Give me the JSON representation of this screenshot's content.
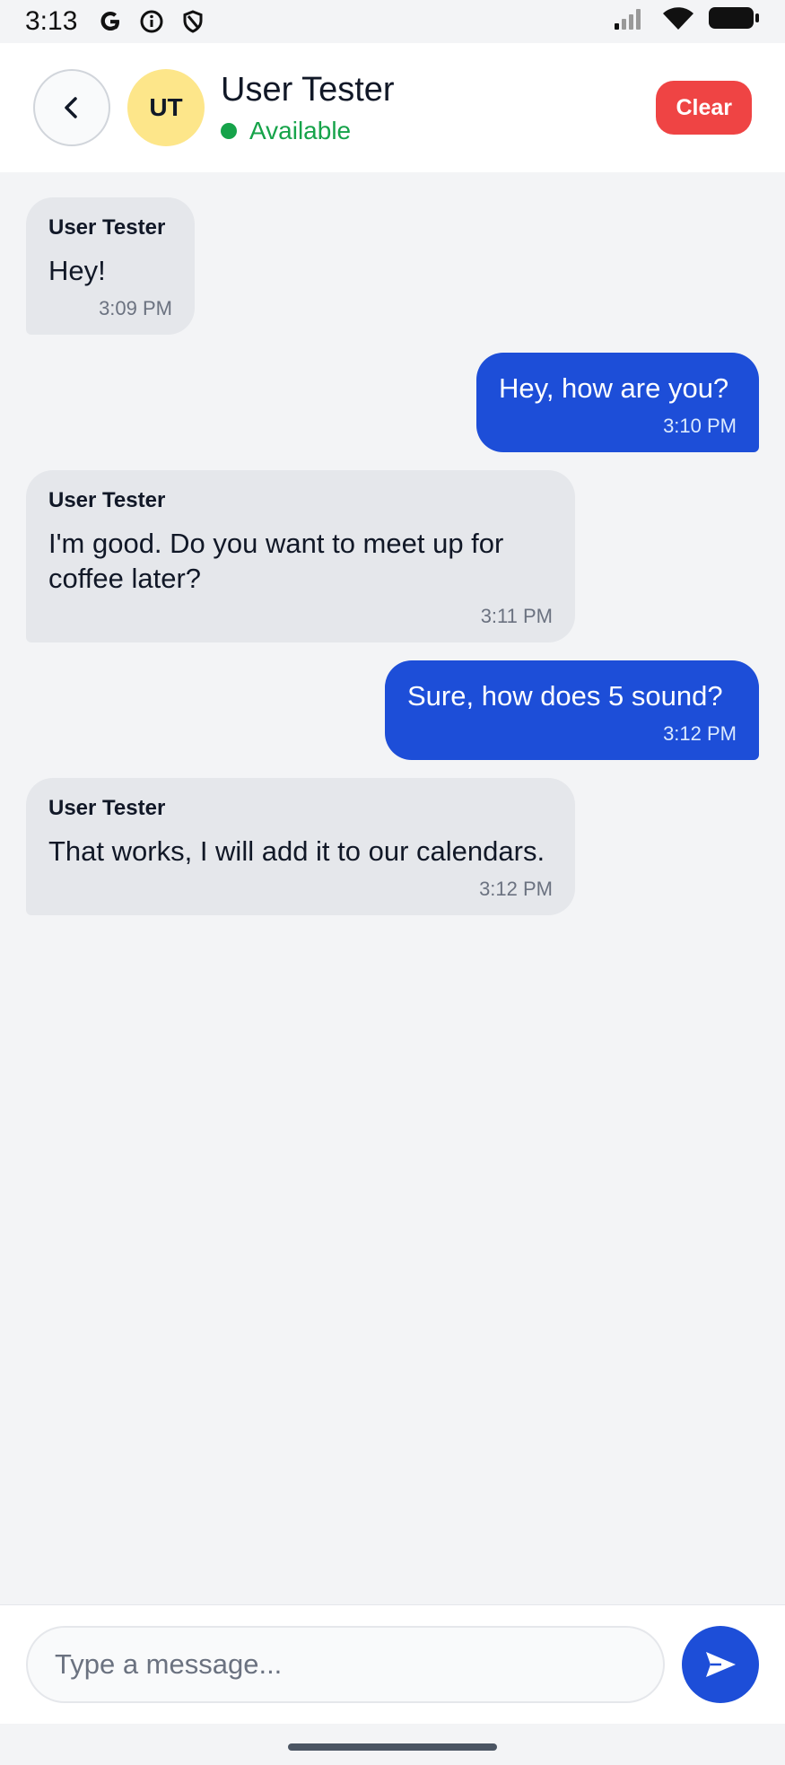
{
  "status_bar": {
    "time": "3:13",
    "icons": [
      "google-icon",
      "info-icon",
      "shield-icon",
      "signal-icon",
      "wifi-icon",
      "battery-icon"
    ]
  },
  "header": {
    "avatar_initials": "UT",
    "contact_name": "User Tester",
    "contact_status": "Available",
    "clear_label": "Clear",
    "colors": {
      "avatar_bg": "#fde68a",
      "status": "#16a34a",
      "clear_bg": "#ef4444"
    }
  },
  "messages": [
    {
      "direction": "received",
      "sender": "User Tester",
      "text": "Hey!",
      "time": "3:09 PM"
    },
    {
      "direction": "sent",
      "text": "Hey, how are you?",
      "time": "3:10 PM"
    },
    {
      "direction": "received",
      "sender": "User Tester",
      "text": "I'm good. Do you want to meet up for coffee later?",
      "time": "3:11 PM"
    },
    {
      "direction": "sent",
      "text": "Sure, how does 5 sound?",
      "time": "3:12 PM"
    },
    {
      "direction": "received",
      "sender": "User Tester",
      "text": "That works, I will add it to our calendars.",
      "time": "3:12 PM"
    }
  ],
  "composer": {
    "placeholder": "Type a message...",
    "value": "",
    "send_color": "#1d4ed8"
  }
}
